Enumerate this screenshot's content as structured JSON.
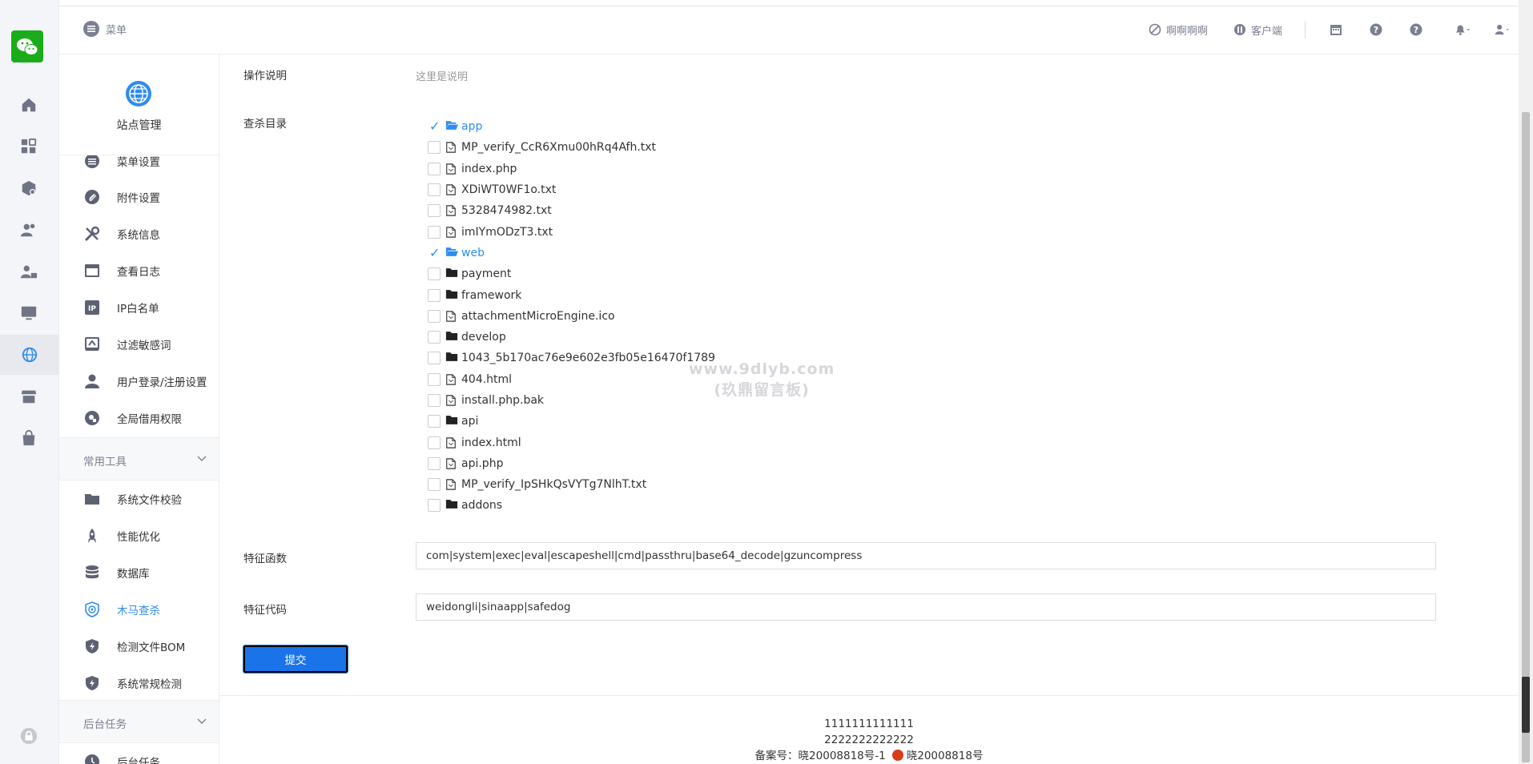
{
  "topbar": {
    "menu_label": "菜单",
    "link1": "啊啊啊啊",
    "link2": "客户端"
  },
  "sidebar": {
    "title": "站点管理",
    "items": [
      {
        "label": "菜单设置",
        "icon": "list-icon"
      },
      {
        "label": "附件设置",
        "icon": "paperclip-icon"
      },
      {
        "label": "系统信息",
        "icon": "tools-icon"
      },
      {
        "label": "查看日志",
        "icon": "calendar-icon"
      },
      {
        "label": "IP白名单",
        "icon": "ip-icon"
      },
      {
        "label": "过滤敏感词",
        "icon": "filter-icon"
      },
      {
        "label": "用户登录/注册设置",
        "icon": "user-icon"
      },
      {
        "label": "全局借用权限",
        "icon": "key-icon"
      }
    ],
    "group1": "常用工具",
    "tools": [
      {
        "label": "系统文件校验",
        "icon": "folder-icon"
      },
      {
        "label": "性能优化",
        "icon": "rocket-icon"
      },
      {
        "label": "数据库",
        "icon": "database-icon"
      },
      {
        "label": "木马查杀",
        "icon": "shield-target-icon",
        "active": true
      },
      {
        "label": "检测文件BOM",
        "icon": "shield-icon"
      },
      {
        "label": "系统常规检测",
        "icon": "shield-check-icon"
      }
    ],
    "group2": "后台任务",
    "tasks": [
      {
        "label": "后台任务",
        "icon": "clock-icon"
      }
    ]
  },
  "form": {
    "desc_label": "操作说明",
    "desc_text": "这里是说明",
    "dir_label": "查杀目录",
    "tree": [
      {
        "name": "app",
        "type": "folder-open",
        "checked": true
      },
      {
        "name": "MP_verify_CcR6Xmu00hRq4Afh.txt",
        "type": "file",
        "checked": false
      },
      {
        "name": "index.php",
        "type": "file",
        "checked": false
      },
      {
        "name": "XDiWT0WF1o.txt",
        "type": "file",
        "checked": false
      },
      {
        "name": "5328474982.txt",
        "type": "file",
        "checked": false
      },
      {
        "name": "imIYmODzT3.txt",
        "type": "file",
        "checked": false
      },
      {
        "name": "web",
        "type": "folder-open",
        "checked": true
      },
      {
        "name": "payment",
        "type": "folder",
        "checked": false
      },
      {
        "name": "framework",
        "type": "folder",
        "checked": false
      },
      {
        "name": "attachmentMicroEngine.ico",
        "type": "file",
        "checked": false
      },
      {
        "name": "develop",
        "type": "folder",
        "checked": false
      },
      {
        "name": "1043_5b170ac76e9e602e3fb05e16470f1789",
        "type": "folder",
        "checked": false
      },
      {
        "name": "404.html",
        "type": "file",
        "checked": false
      },
      {
        "name": "install.php.bak",
        "type": "file",
        "checked": false
      },
      {
        "name": "api",
        "type": "folder",
        "checked": false
      },
      {
        "name": "index.html",
        "type": "file",
        "checked": false
      },
      {
        "name": "api.php",
        "type": "file",
        "checked": false
      },
      {
        "name": "MP_verify_IpSHkQsVYTg7NlhT.txt",
        "type": "file",
        "checked": false
      },
      {
        "name": "addons",
        "type": "folder",
        "checked": false
      }
    ],
    "func_label": "特征函数",
    "func_value": "com|system|exec|eval|escapeshell|cmd|passthru|base64_decode|gzuncompress",
    "code_label": "特征代码",
    "code_value": "weidongli|sinaapp|safedog",
    "submit_label": "提交"
  },
  "footer": {
    "line1": "1111111111111",
    "line2": "2222222222222",
    "beian1": "备案号：晓20008818号-1",
    "beian2": "晓20008818号"
  },
  "watermark": {
    "line1": "www.9dlyb.com",
    "line2": "(玖鼎留言板)"
  },
  "colors": {
    "accent": "#2d8cf0",
    "button": "#1a73e8",
    "logo": "#1aad19"
  }
}
